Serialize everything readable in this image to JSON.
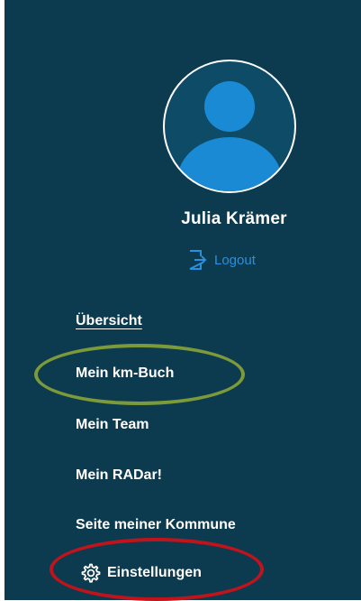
{
  "user": {
    "name": "Julia Krämer",
    "avatar_icon": "user-avatar-icon"
  },
  "logout": {
    "label": "Logout",
    "icon": "logout-icon",
    "color": "#2a8fe0"
  },
  "nav": {
    "items": [
      {
        "label": "Übersicht",
        "active": true
      },
      {
        "label": "Mein km-Buch",
        "active": false
      },
      {
        "label": "Mein Team",
        "active": false
      },
      {
        "label": "Mein RADar!",
        "active": false
      },
      {
        "label": "Seite meiner Kommune",
        "active": false
      },
      {
        "label": "Einstellungen",
        "active": false,
        "icon": "gear-icon"
      }
    ]
  },
  "theme": {
    "panel_bg": "#0c3a4e",
    "avatar_bg": "#0e4b66",
    "avatar_figure": "#1a8ad4",
    "highlight_green": "#7c9a3a",
    "highlight_red": "#c0141c"
  }
}
